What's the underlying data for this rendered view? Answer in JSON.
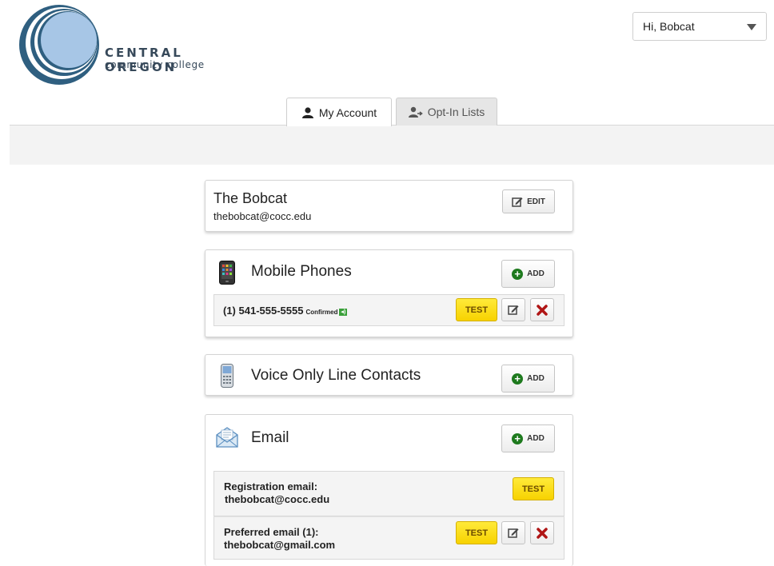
{
  "logo": {
    "line1": "CENTRAL OREGON",
    "line2": "community college"
  },
  "user_menu": {
    "label": "Hi, Bobcat"
  },
  "tabs": [
    {
      "label": "My Account",
      "active": true
    },
    {
      "label": "Opt-In Lists",
      "active": false
    }
  ],
  "profile": {
    "name": "The Bobcat",
    "email": "thebobcat@cocc.edu",
    "edit_label": "EDIT"
  },
  "mobile_phones": {
    "title": "Mobile Phones",
    "add_label": "ADD",
    "items": [
      {
        "number": "(1) 541-555-5555",
        "status": "Confirmed",
        "test_label": "TEST"
      }
    ]
  },
  "voice_only": {
    "title": "Voice Only Line Contacts",
    "add_label": "ADD"
  },
  "email": {
    "title": "Email",
    "add_label": "ADD",
    "items": [
      {
        "label": "Registration email:",
        "value": "thebobcat@cocc.edu",
        "test_label": "TEST"
      },
      {
        "label": "Preferred email (1):",
        "value": "thebobcat@gmail.com",
        "test_label": "TEST"
      }
    ]
  },
  "colors": {
    "accent_yellow": "#f7d200",
    "logo_blue": "#2f5f80",
    "delete_red": "#b01616",
    "add_green": "#1e7a1e"
  }
}
